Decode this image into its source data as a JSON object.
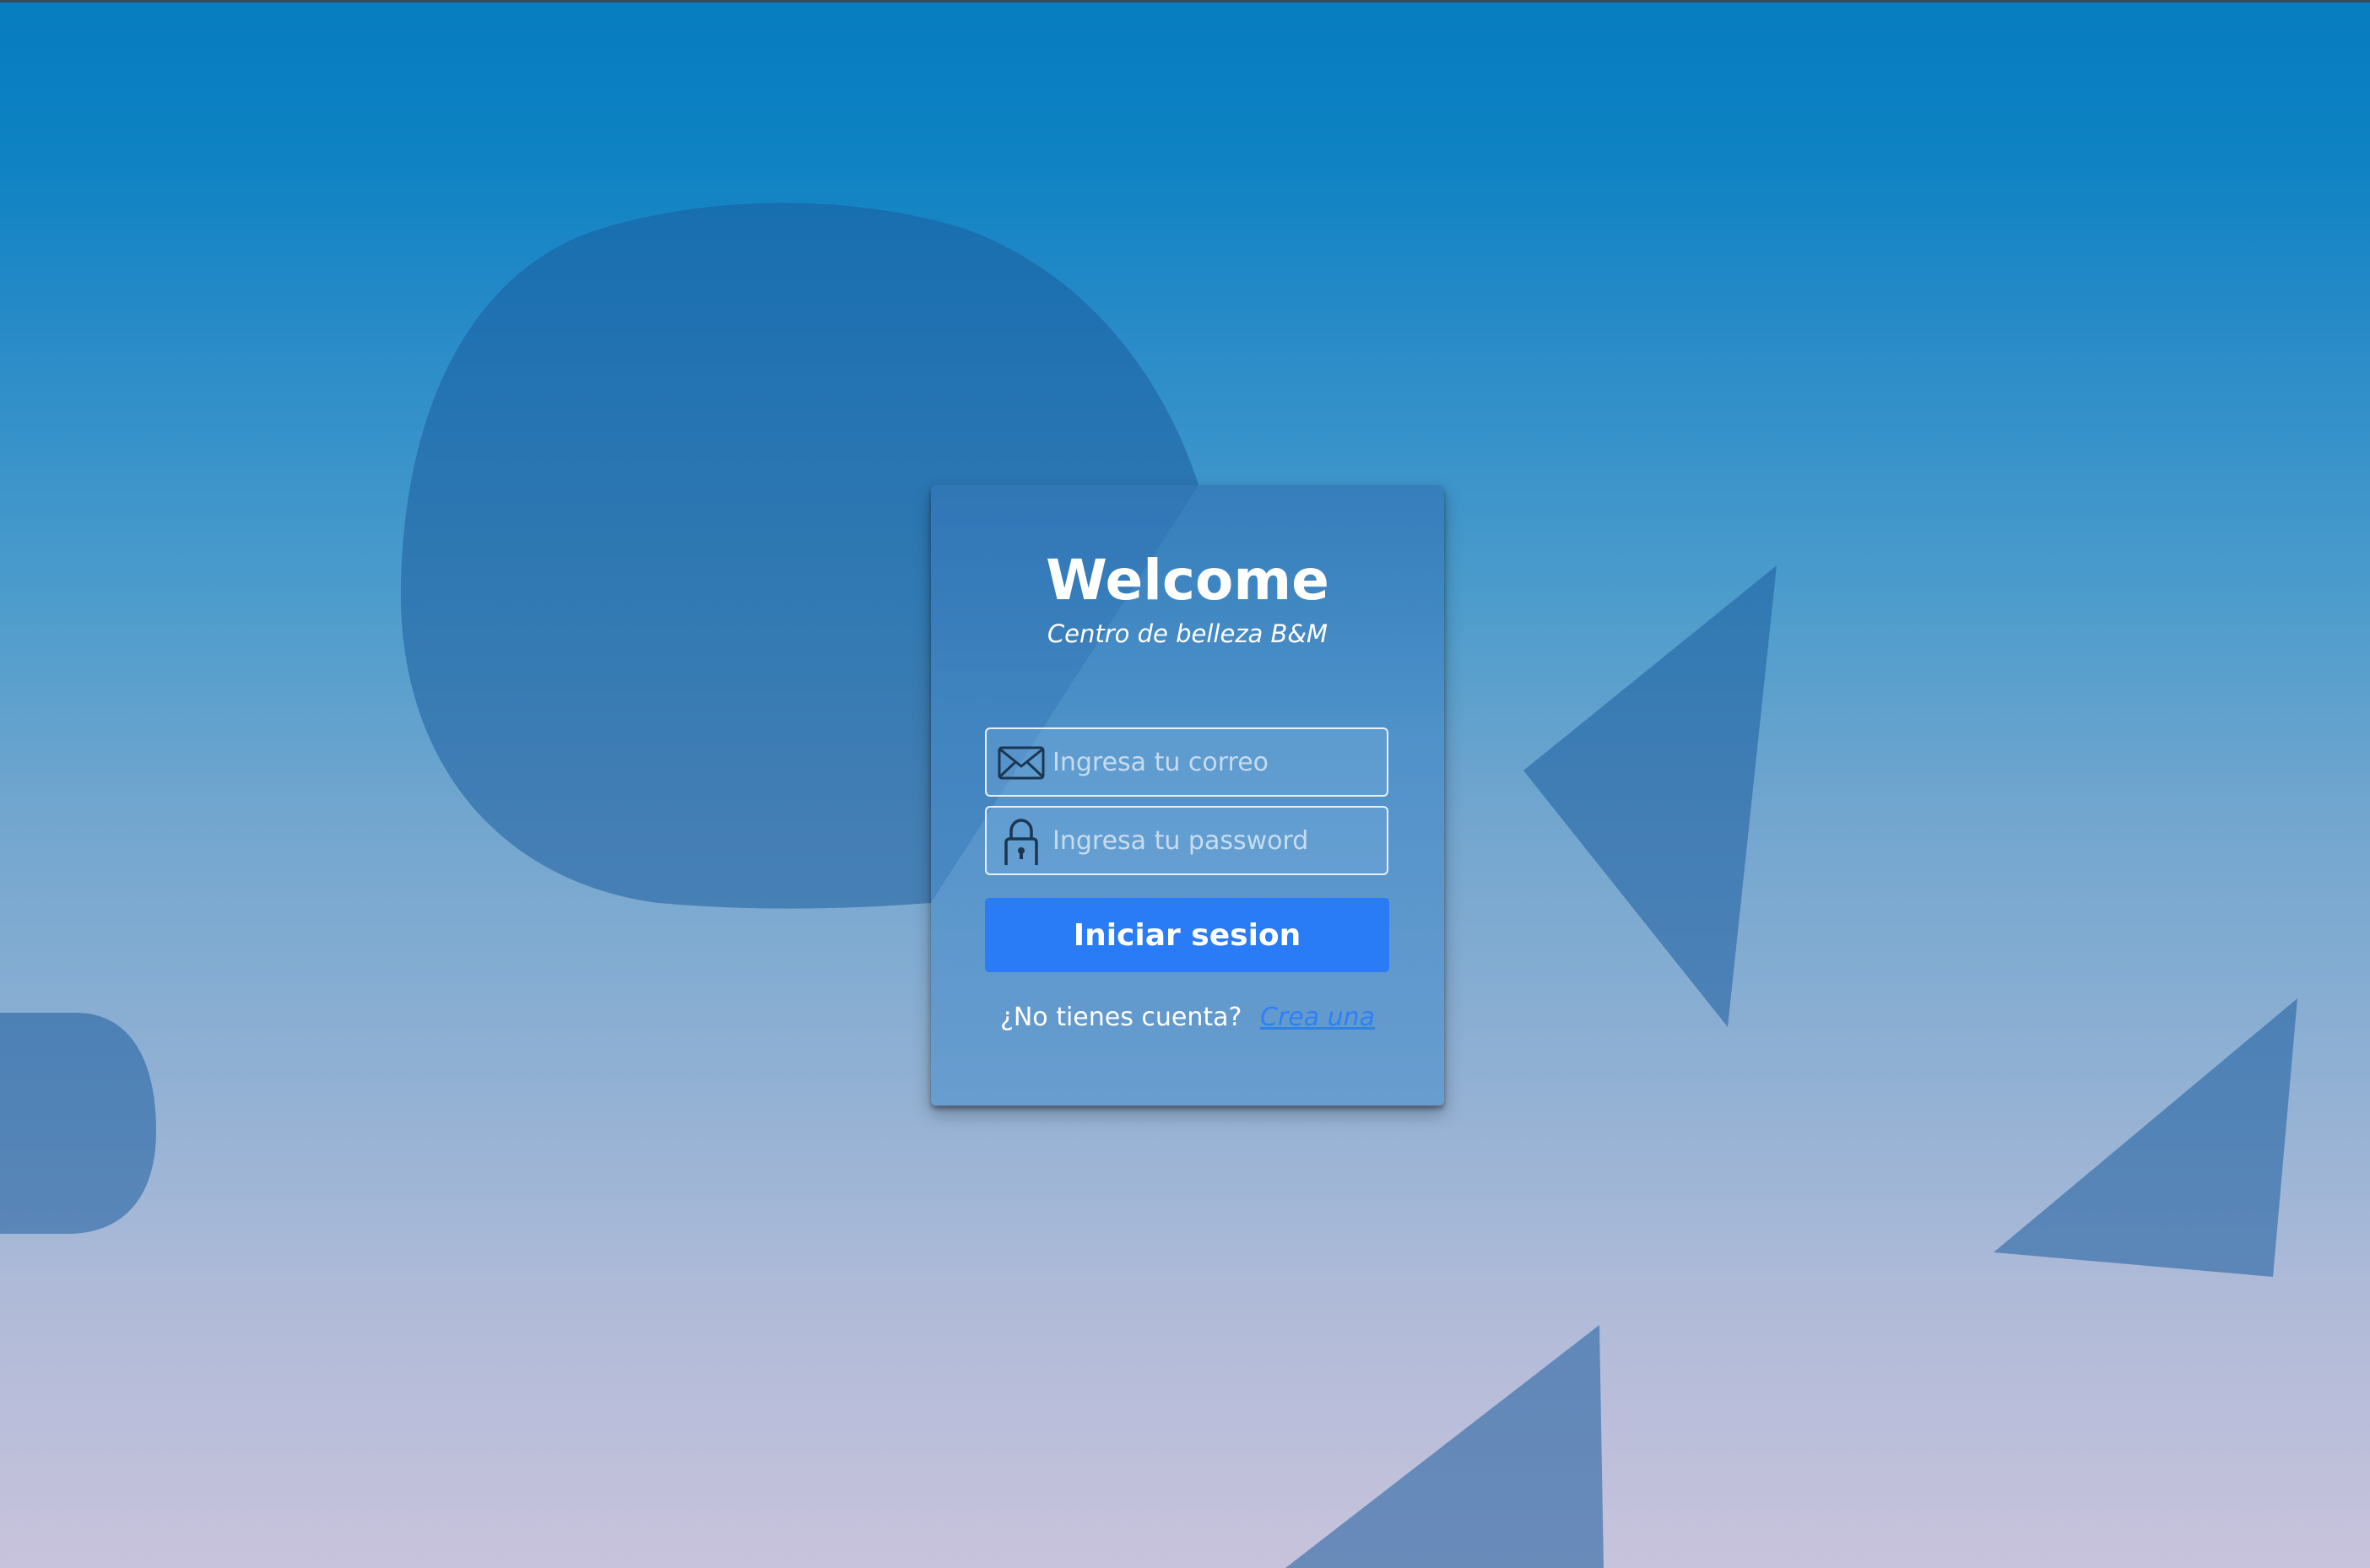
{
  "login": {
    "title": "Welcome",
    "subtitle": "Centro de belleza B&M",
    "email": {
      "icon": "envelope-icon",
      "placeholder": "Ingresa tu correo",
      "value": ""
    },
    "password": {
      "icon": "padlock-icon",
      "placeholder": "Ingresa tu password",
      "value": ""
    },
    "submit_label": "Iniciar sesion",
    "signup_prompt": "¿No tienes cuenta?",
    "signup_link": "Crea una"
  },
  "colors": {
    "button": "#2a7cf6",
    "link": "#2f7ff5",
    "icon_stroke": "#1b3650",
    "shape_fill": "#3568a6"
  }
}
